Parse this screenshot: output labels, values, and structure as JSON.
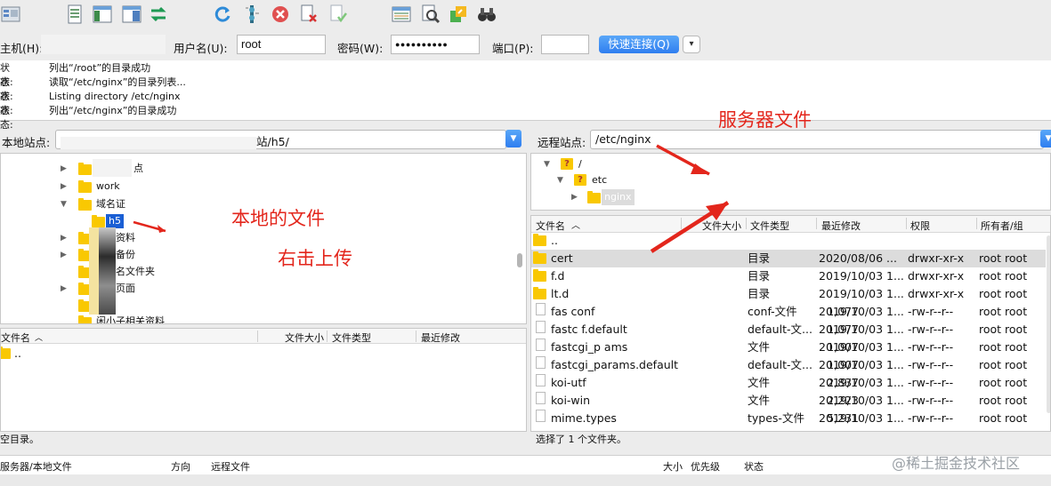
{
  "quickconnect": {
    "host_label": "主机(H):",
    "user_label": "用户名(U):",
    "user_value": "root",
    "password_label": "密码(W):",
    "password_value": "●●●●●●●●●●",
    "port_label": "端口(P):",
    "port_value": "",
    "connect_label": "快速连接(Q)",
    "dropdown_glyph": "▾"
  },
  "log": [
    {
      "status": "状态:",
      "message": "列出“/root”的目录成功"
    },
    {
      "status": "状态:",
      "message": "读取“/etc/nginx”的目录列表..."
    },
    {
      "status": "状态:",
      "message": "Listing directory /etc/nginx"
    },
    {
      "status": "状态:",
      "message": "列出“/etc/nginx”的目录成功"
    }
  ],
  "local": {
    "site_label": "本地站点:",
    "path_tail": "站/h5/",
    "tree": [
      {
        "label": "点",
        "expanded": false
      },
      {
        "label": "work",
        "expanded": false
      },
      {
        "label": "域名证",
        "expanded": true
      },
      {
        "label": "h5",
        "selected": true
      },
      {
        "label": "资料",
        "expanded": false
      },
      {
        "label": "备份",
        "expanded": false
      },
      {
        "label": "名文件夹",
        "expanded": false
      },
      {
        "label": "页面",
        "expanded": false
      },
      {
        "label": "",
        "expanded": false
      },
      {
        "label": "闲小子相关资料",
        "expanded": false
      }
    ],
    "columns": [
      "文件名",
      "文件大小",
      "文件类型",
      "最近修改"
    ],
    "files": [
      ".."
    ],
    "status": "空目录。"
  },
  "remote": {
    "site_label": "远程站点:",
    "path": "/etc/nginx",
    "tree": [
      {
        "label": "/"
      },
      {
        "label": "etc"
      },
      {
        "label": "nginx"
      }
    ],
    "columns": [
      "文件名",
      "文件大小",
      "文件类型",
      "最近修改",
      "权限",
      "所有者/组"
    ],
    "files": [
      {
        "name": "..",
        "size": "",
        "type": "",
        "modified": "",
        "perms": "",
        "owner": "",
        "kind": "folder"
      },
      {
        "name": "cert",
        "size": "",
        "type": "目录",
        "modified": "2020/08/06 ...",
        "perms": "drwxr-xr-x",
        "owner": "root root",
        "kind": "folder",
        "selected": true
      },
      {
        "name": "f.d",
        "size": "",
        "type": "目录",
        "modified": "2019/10/03 1...",
        "perms": "drwxr-xr-x",
        "owner": "root root",
        "kind": "folder"
      },
      {
        "name": "lt.d",
        "size": "",
        "type": "目录",
        "modified": "2019/10/03 1...",
        "perms": "drwxr-xr-x",
        "owner": "root root",
        "kind": "folder"
      },
      {
        "name": "fas    conf",
        "size": "1,077",
        "type": "conf-文件",
        "modified": "2019/10/03 1...",
        "perms": "-rw-r--r--",
        "owner": "root root",
        "kind": "file"
      },
      {
        "name": "fastc     f.default",
        "size": "1,077",
        "type": "default-文...",
        "modified": "2019/10/03 1...",
        "perms": "-rw-r--r--",
        "owner": "root root",
        "kind": "file"
      },
      {
        "name": "fastcgi_p   ams",
        "size": "1,007",
        "type": "文件",
        "modified": "2019/10/03 1...",
        "perms": "-rw-r--r--",
        "owner": "root root",
        "kind": "file"
      },
      {
        "name": "fastcgi_params.default",
        "size": "1,007",
        "type": "default-文...",
        "modified": "2019/10/03 1...",
        "perms": "-rw-r--r--",
        "owner": "root root",
        "kind": "file"
      },
      {
        "name": "koi-utf",
        "size": "2,837",
        "type": "文件",
        "modified": "2019/10/03 1...",
        "perms": "-rw-r--r--",
        "owner": "root root",
        "kind": "file"
      },
      {
        "name": "koi-win",
        "size": "2,223",
        "type": "文件",
        "modified": "2019/10/03 1...",
        "perms": "-rw-r--r--",
        "owner": "root root",
        "kind": "file"
      },
      {
        "name": "mime.types",
        "size": "5,231",
        "type": "types-文件",
        "modified": "2019/10/03 1...",
        "perms": "-rw-r--r--",
        "owner": "root root",
        "kind": "file"
      }
    ],
    "status": "选择了 1 个文件夹。"
  },
  "queue": {
    "columns": [
      "服务器/本地文件",
      "方向",
      "远程文件",
      "大小",
      "优先级",
      "状态"
    ]
  },
  "annotations": {
    "local_files": "本地的文件",
    "right_click_upload": "右击上传",
    "server_files": "服务器文件",
    "color": "#e3261c"
  },
  "watermark": "@稀土掘金技术社区"
}
